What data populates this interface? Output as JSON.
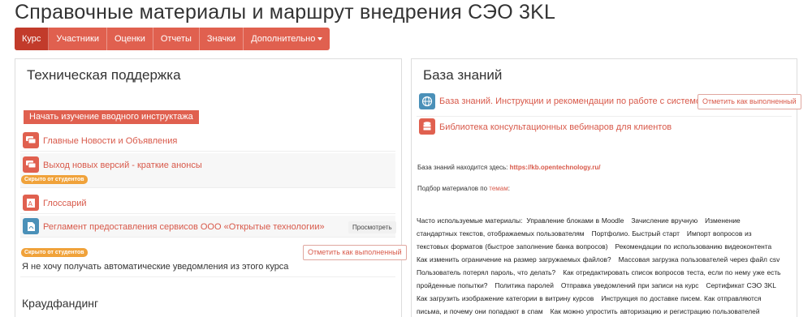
{
  "page": {
    "title": "Справочные материалы и маршрут внедрения СЭО 3KL"
  },
  "nav": {
    "tabs": [
      "Курс",
      "Участники",
      "Оценки",
      "Отчеты",
      "Значки",
      "Дополнительно"
    ],
    "active": "Курс"
  },
  "left_panel": {
    "title": "Техническая поддержка",
    "intro_button": "Начать изучение вводного инструктажа",
    "activities": [
      {
        "label": "Главные Новости и Объявления",
        "icon": "forum-icon",
        "icon_color": "#e0604f"
      },
      {
        "label": "Выход новых версий - краткие анонсы",
        "icon": "forum-icon",
        "icon_color": "#e0604f",
        "badge": "Скрыто от студентов"
      },
      {
        "label": "Глоссарий",
        "icon": "glossary-icon",
        "icon_color": "#e0604f"
      },
      {
        "label": "Регламент предоставления сервисов ООО «Открытые технологии»",
        "icon": "pdf-icon",
        "icon_color": "#4a90b8",
        "action": "Просмотреть"
      }
    ],
    "hidden_badge": "Скрыто от студентов",
    "notice_text": "Я не хочу получать автоматические уведомления из этого курса",
    "complete_button": "Отметить как выполненный",
    "next_section_title": "Краудфандинг"
  },
  "right_panel": {
    "title": "База знаний",
    "resources": [
      {
        "label": "База знаний. Инструкции и рекомендации по работе с системой.",
        "icon": "globe-icon",
        "icon_color": "#4a90b8",
        "complete_button": "Отметить как выполненный"
      },
      {
        "label": "Библиотека консультационных вебинаров для клиентов",
        "icon": "database-icon",
        "icon_color": "#e0604f"
      }
    ],
    "kb_location_text": "База знаний находится здесь: ",
    "kb_url": "https://kb.opentechnology.ru/",
    "topics_prefix": "Подбор материалов по ",
    "topics_link": "темам",
    "topics_suffix": ":",
    "materials_prefix": "Часто используемые материалы:",
    "materials": [
      "Управление блоками в Moodle",
      "Зачисление вручную",
      "Изменение стандартных текстов, отображаемых пользователям",
      "Портфолио. Быстрый старт",
      "Импорт вопросов из текстовых форматов (быстрое заполнение банка вопросов)",
      "Рекомендации по использованию видеоконтента",
      "Как изменить ограничение на размер загружаемых файлов?",
      "Массовая загрузка пользователей через файл csv",
      "Пользователь потерял пароль, что делать?",
      "Как отредактировать список вопросов теста, если по нему уже есть пройденные попытки?",
      "Политика паролей",
      "Отправка уведомлений при записи на курс",
      "Сертификат СЭО 3KL",
      "Как загрузить изображение категории в витрину курсов",
      "Инструкция по доставке писем. Как отправляются письма, и почему они попадают в спам",
      "Как можно упростить авторизацию и регистрацию пользователей"
    ]
  }
}
